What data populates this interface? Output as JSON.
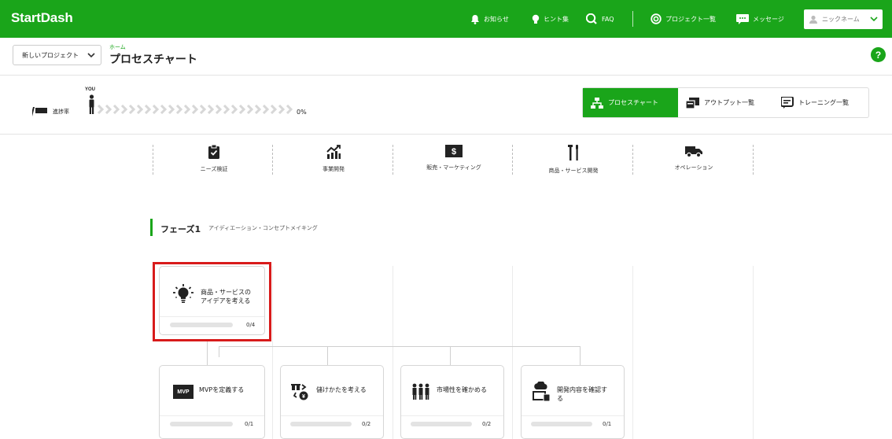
{
  "app": {
    "brand": "StartDash"
  },
  "nav": {
    "news": "お知らせ",
    "hints": "ヒント集",
    "faq": "FAQ",
    "projects": "プロジェクト一覧",
    "messages": "メッセージ",
    "nickname": "ニックネーム"
  },
  "subheader": {
    "project_select": "新しいプロジェクト",
    "breadcrumb_home": "ホーム",
    "page_title": "プロセスチャート",
    "help": "?"
  },
  "progress": {
    "label": "進捗率",
    "you": "YOU",
    "percent_label": "0%",
    "value": 0
  },
  "view_tabs": [
    {
      "label": "プロセスチャート",
      "active": true
    },
    {
      "label": "アウトプット一覧",
      "active": false
    },
    {
      "label": "トレーニング一覧",
      "active": false
    }
  ],
  "categories": [
    {
      "label": "ニーズ検証",
      "icon": "clipboard-check-icon"
    },
    {
      "label": "事業開発",
      "icon": "growth-chart-icon"
    },
    {
      "label": "販売・マーケティング",
      "icon": "dollar-bill-icon"
    },
    {
      "label": "商品・サービス開発",
      "icon": "tools-icon"
    },
    {
      "label": "オペレーション",
      "icon": "delivery-truck-icon"
    }
  ],
  "phase": {
    "title": "フェーズ1",
    "subtitle": "アイディエーション・コンセプトメイキング"
  },
  "tasks": {
    "root": {
      "name_line1": "商品・サービスの",
      "name_line2": "アイデアを考える",
      "count": "0/4",
      "progress": 0
    },
    "children": [
      {
        "name_line1": "MVPを定義する",
        "name_line2": "",
        "count": "0/1",
        "progress": 0,
        "icon_text": "MVP"
      },
      {
        "name_line1": "儲けかたを考える",
        "name_line2": "",
        "count": "0/2",
        "progress": 0
      },
      {
        "name_line1": "市場性を確かめる",
        "name_line2": "",
        "count": "0/2",
        "progress": 0
      },
      {
        "name_line1": "開発内容を確認す",
        "name_line2": "る",
        "count": "0/1",
        "progress": 0
      }
    ]
  },
  "colors": {
    "brand_green": "#1aa51a",
    "highlight_red": "#d81b1b"
  }
}
